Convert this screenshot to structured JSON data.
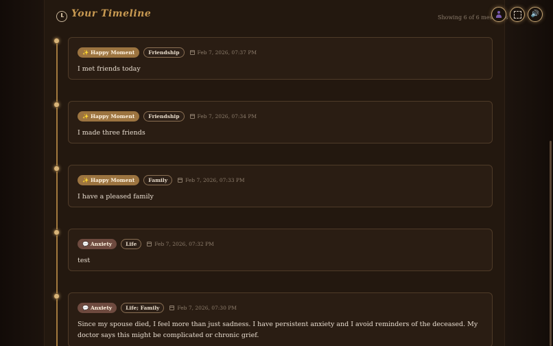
{
  "header": {
    "title": "Your Timeline",
    "showing": "Showing 6 of 6 messages",
    "icons": [
      "clock-icon",
      "avatar-icon",
      "fullscreen-icon",
      "speaker-icon"
    ]
  },
  "entries": [
    {
      "mood": "✨ Happy Moment",
      "mood_type": "happy",
      "topic": "Friendship",
      "date": "Feb 7, 2026, 07:37 PM",
      "text": "I met friends today"
    },
    {
      "mood": "✨ Happy Moment",
      "mood_type": "happy",
      "topic": "Friendship",
      "date": "Feb 7, 2026, 07:34 PM",
      "text": "I made three friends"
    },
    {
      "mood": "✨ Happy Moment",
      "mood_type": "happy",
      "topic": "Family",
      "date": "Feb 7, 2026, 07:33 PM",
      "text": "I have a pleased family"
    },
    {
      "mood": "💬 Anxiety",
      "mood_type": "anxiety",
      "topic": "Life",
      "date": "Feb 7, 2026, 07:32 PM",
      "text": "test"
    },
    {
      "mood": "💬 Anxiety",
      "mood_type": "anxiety",
      "topic": "Life; Family",
      "date": "Feb 7, 2026, 07:30 PM",
      "text": "Since my spouse died, I feel more than just sadness. I have persistent anxiety and I avoid reminders of the deceased. My doctor says this might be complicated or chronic grief."
    }
  ],
  "colors": {
    "accent": "#c99a52",
    "happy": "#9c7440",
    "anxiety": "#6e4a3f",
    "background": "#23180f"
  }
}
